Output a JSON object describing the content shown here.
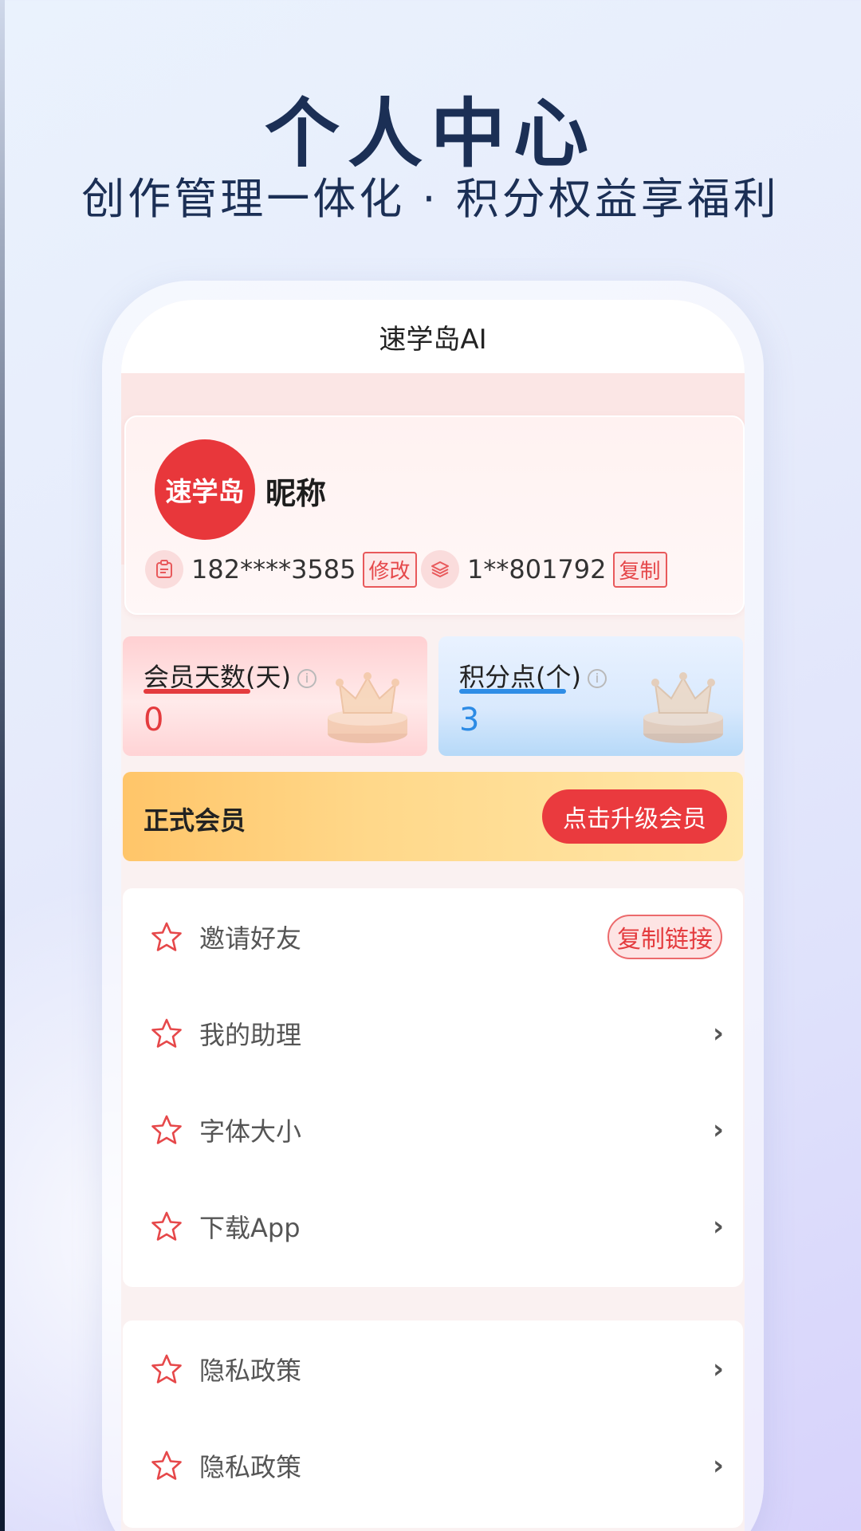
{
  "hero": {
    "title": "个人中心",
    "subtitle": "创作管理一体化 · 积分权益享福利"
  },
  "app": {
    "header_title": "速学岛AI"
  },
  "profile": {
    "avatar_text": "速学岛",
    "nickname": "昵称",
    "phone": "182****3585",
    "phone_action": "修改",
    "user_id": "1**801792",
    "id_action": "复制"
  },
  "stats": {
    "member_days_label": "会员天数(天)",
    "member_days_value": "0",
    "points_label": "积分点(个)",
    "points_value": "3",
    "info_glyph": "i"
  },
  "membership": {
    "label": "正式会员",
    "upgrade_button": "点击升级会员"
  },
  "menu": {
    "invite": {
      "label": "邀请好友",
      "action": "复制链接"
    },
    "items": [
      {
        "label": "我的助理"
      },
      {
        "label": "字体大小"
      },
      {
        "label": "下载App"
      }
    ],
    "items2": [
      {
        "label": "隐私政策"
      },
      {
        "label": "隐私政策"
      }
    ],
    "chevron": "›"
  },
  "colors": {
    "brand_red": "#e8373b",
    "accent_blue": "#2c8be5",
    "hero_text": "#1b2f55"
  }
}
